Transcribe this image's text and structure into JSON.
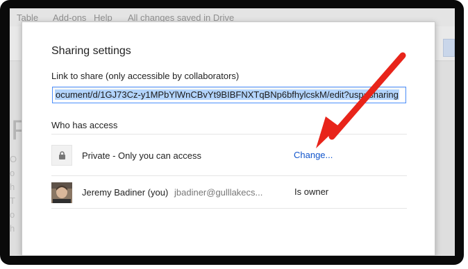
{
  "background_app": {
    "menu": [
      "Table",
      "Add-ons",
      "Help"
    ],
    "save_status": "All changes saved in Drive"
  },
  "dialog": {
    "title": "Sharing settings",
    "link_label": "Link to share (only accessible by collaborators)",
    "link_value": "ocument/d/1GJ73Cz-y1MPbYlWnCBvYt9BIBFNXTqBNp6bfhylcskM/edit?usp=sharing",
    "who_has_access_label": "Who has access",
    "private_row": {
      "icon": "lock-icon",
      "label": "Private - Only you can access",
      "change_link": "Change..."
    },
    "owner_row": {
      "name": "Jeremy Badiner (you)",
      "email": "jbadiner@gulllakecs...",
      "role": "Is owner"
    }
  },
  "annotation": {
    "arrow_color": "#e8241a"
  }
}
